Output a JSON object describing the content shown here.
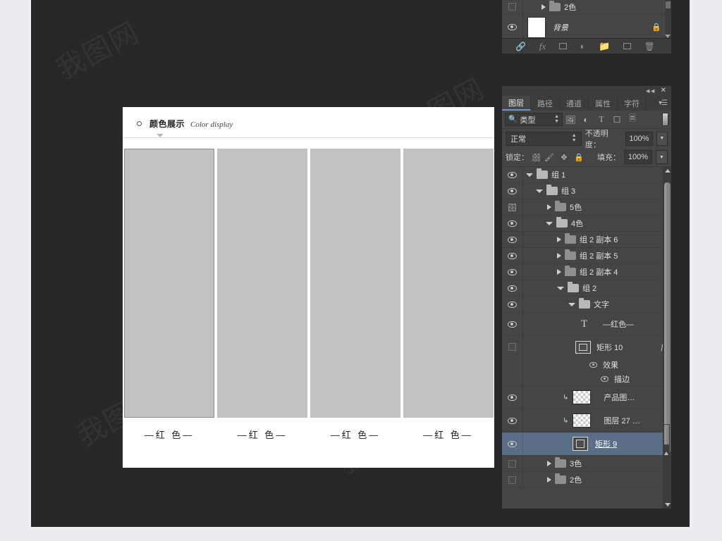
{
  "app": {
    "background_color": "#272727",
    "page_bg": "#ebedf0"
  },
  "document": {
    "title_cn": "颜色展示",
    "title_en": "Color display",
    "swatch_labels": [
      "—红 色—",
      "—红 色—",
      "—红 色—",
      "—红 色—"
    ],
    "swatch_color": "#c2c2c2",
    "selected_swatch_index": 0
  },
  "top_panel": {
    "rows": [
      {
        "name": "2色",
        "type": "folder",
        "visible": false,
        "expanded": false,
        "indent": 2
      },
      {
        "name": "背景",
        "type": "raster",
        "visible": true,
        "locked": true,
        "italic": true,
        "indent": 1
      }
    ],
    "toolbar_icons": [
      "link-icon",
      "fx-icon",
      "mask-icon",
      "adjustment-icon",
      "new-group-icon",
      "new-layer-icon",
      "delete-icon"
    ]
  },
  "panel": {
    "titlebar": {
      "collapse": "◄◄",
      "close": "✕"
    },
    "tabs": [
      {
        "label": "图层",
        "active": true
      },
      {
        "label": "路径",
        "active": false
      },
      {
        "label": "通道",
        "active": false
      },
      {
        "label": "属性",
        "active": false
      },
      {
        "label": "字符",
        "active": false
      }
    ],
    "menu_icon": "panel-menu-icon",
    "filter": {
      "kind_label": "类型",
      "icons": [
        "pixel-filter-icon",
        "adjustment-filter-icon",
        "type-filter-icon",
        "shape-filter-icon",
        "smartobject-filter-icon"
      ]
    },
    "blend": {
      "mode": "正常",
      "opacity_label": "不透明度：",
      "opacity_value": "100%"
    },
    "lock": {
      "label": "锁定：",
      "icons": [
        "lock-transparency-icon",
        "lock-image-icon",
        "lock-position-icon",
        "lock-all-icon"
      ],
      "fill_label": "填充：",
      "fill_value": "100%"
    },
    "layers": [
      {
        "name": "组 1",
        "type": "folder",
        "visible": true,
        "expanded": true,
        "indent": 0
      },
      {
        "name": "组 3",
        "type": "folder",
        "visible": true,
        "expanded": true,
        "indent": 1
      },
      {
        "name": "5色",
        "type": "folder",
        "visible": false,
        "expanded": false,
        "indent": 2,
        "dark_folder": true
      },
      {
        "name": "4色",
        "type": "folder",
        "visible": true,
        "expanded": true,
        "indent": 2
      },
      {
        "name": "组 2 副本 6",
        "type": "folder",
        "visible": true,
        "expanded": false,
        "indent": 3,
        "dark_folder": true
      },
      {
        "name": "组 2 副本 5",
        "type": "folder",
        "visible": true,
        "expanded": false,
        "indent": 3,
        "dark_folder": true
      },
      {
        "name": "组 2 副本 4",
        "type": "folder",
        "visible": true,
        "expanded": false,
        "indent": 3,
        "dark_folder": true
      },
      {
        "name": "组 2",
        "type": "folder",
        "visible": true,
        "expanded": true,
        "indent": 3
      },
      {
        "name": "文字",
        "type": "folder",
        "visible": true,
        "expanded": true,
        "indent": 4
      },
      {
        "name": "—红色—",
        "type": "text",
        "visible": true,
        "indent": 5
      },
      {
        "name": "矩形 10",
        "type": "vector",
        "visible": false,
        "indent": 5,
        "has_fx": true,
        "tall": true
      },
      {
        "name": "效果",
        "type": "effects",
        "visible": true,
        "indent": 6
      },
      {
        "name": "描边",
        "type": "effect",
        "visible": true,
        "indent": 7
      },
      {
        "name": "产品图…",
        "type": "raster",
        "visible": true,
        "indent": 5,
        "clipped": true
      },
      {
        "name": "图层 27 …",
        "type": "raster",
        "visible": true,
        "indent": 5,
        "clipped": true
      },
      {
        "name": "矩形 9",
        "type": "vector",
        "visible": true,
        "indent": 5,
        "selected": true,
        "editing": true
      },
      {
        "name": "3色",
        "type": "folder",
        "visible": false,
        "expanded": false,
        "indent": 3,
        "dark_folder": true
      },
      {
        "name": "2色",
        "type": "folder",
        "visible": false,
        "expanded": false,
        "indent": 3,
        "dark_folder": true
      }
    ]
  },
  "watermark_text": "我图网"
}
